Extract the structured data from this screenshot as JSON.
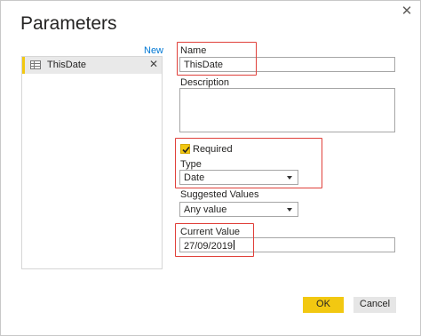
{
  "dialog": {
    "title": "Parameters",
    "close_glyph": "✕",
    "new_link": "New"
  },
  "parameters": [
    {
      "name": "ThisDate",
      "icon": "parameter-table-icon",
      "remove_glyph": "✕"
    }
  ],
  "form": {
    "name_label": "Name",
    "name_value": "ThisDate",
    "description_label": "Description",
    "description_value": "",
    "required_label": "Required",
    "required_checked": true,
    "type_label": "Type",
    "type_value": "Date",
    "suggested_values_label": "Suggested Values",
    "suggested_values_value": "Any value",
    "current_value_label": "Current Value",
    "current_value_value": "27/09/2019"
  },
  "buttons": {
    "ok": "OK",
    "cancel": "Cancel"
  },
  "colors": {
    "accent": "#f2c811",
    "annotation": "#e0403a",
    "link": "#0078d4"
  }
}
